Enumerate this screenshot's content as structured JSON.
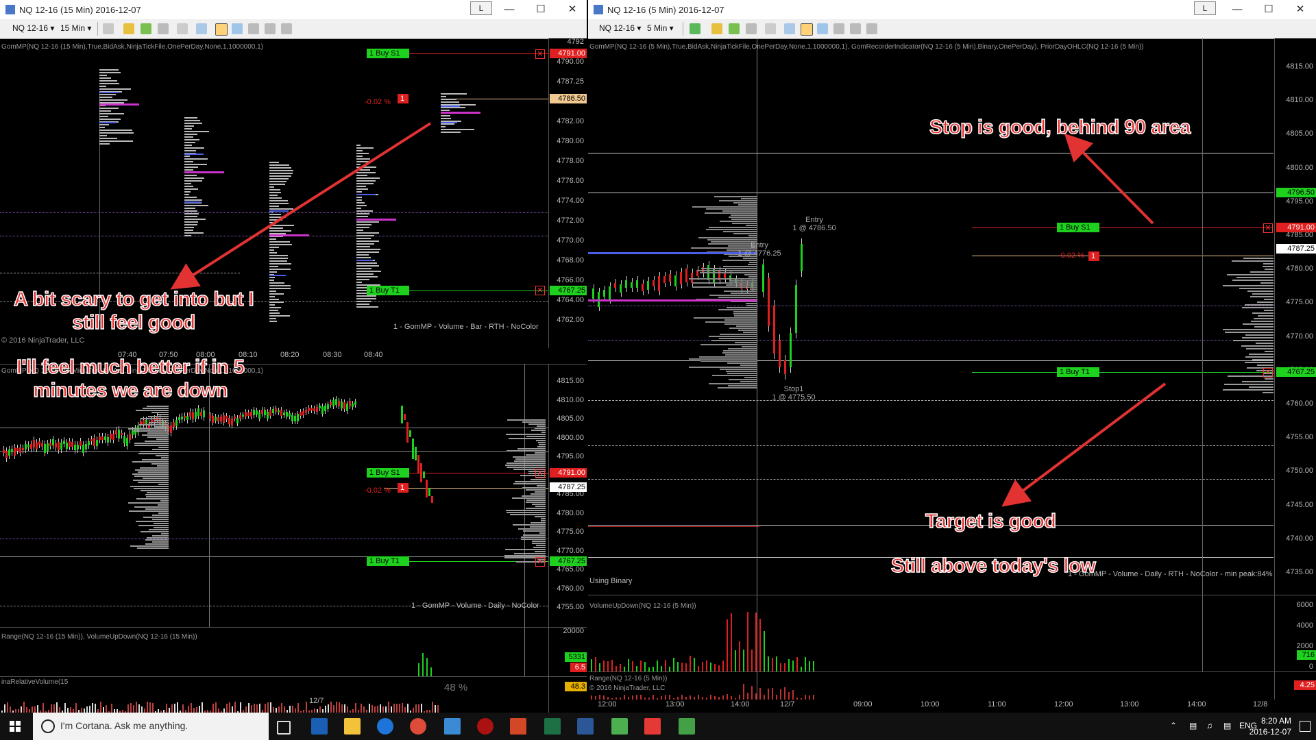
{
  "windows": {
    "left": {
      "title": "NQ 12-16 (15 Min)  2016-12-07",
      "lbtn": "L",
      "toolbar": {
        "instrument": "NQ 12-16",
        "interval": "15 Min"
      },
      "top_panel": {
        "indicator_label": "GomMP(NQ 12-16 (15 Min),True,BidAsk,NinjaTickFile,OnePerDay,None,1,1000000,1)",
        "ticks": [
          "4792",
          "4790.00",
          "4787.25",
          "4784.00",
          "4782.00",
          "4780.00",
          "4778.00",
          "4776.00",
          "4774.00",
          "4772.00",
          "4770.00",
          "4768.00",
          "4766.00",
          "4764.00",
          "4762.00"
        ],
        "price_tags": {
          "stop": "4791.00",
          "last": "4786.50",
          "target": "4767.25"
        },
        "orders": {
          "stop_label": "1  Buy S1",
          "target_label": "1  Buy T1",
          "pct": "-0.02 %",
          "qty": "1"
        },
        "footer": "1 - GomMP  - Volume - Bar - RTH - NoColor",
        "copyright": "© 2016 NinjaTrader, LLC",
        "x_labels": [
          "07:40",
          "07:50",
          "08:00",
          "08:10",
          "08:20",
          "08:30",
          "08:40"
        ]
      },
      "mid_panel": {
        "indicator_label": "GomMP(NQ 12-16 (15 Min),True,BidAsk,NinjaTickFile,OnePerDay,None,1,1000000,1)",
        "ticks": [
          "4815.00",
          "4810.00",
          "4805.00",
          "4800.00",
          "4795.00",
          "4790.00",
          "4785.00",
          "4780.00",
          "4775.00",
          "4770.00",
          "4765.00",
          "4760.00",
          "4755.00"
        ],
        "price_tags": {
          "stop": "4791.00",
          "last": "4787.25",
          "target": "4767.25"
        },
        "orders": {
          "stop_label": "1  Buy S1",
          "target_label": "1  Buy T1",
          "pct": "-0.02 %",
          "qty": "1"
        },
        "footer": "1 - GomMP  - Volume - Daily - NoColor"
      },
      "vol_panel": {
        "label": "Range(NQ 12-16 (15 Min)), VolumeUpDown(NQ 12-16 (15 Min))",
        "tick": "20000",
        "tags": [
          "5331",
          "6.5"
        ]
      },
      "rel_panel": {
        "label": "inaRelativeVolume(15",
        "pct": "48 %",
        "tag": "48.3",
        "x_label": "12/7"
      }
    },
    "right": {
      "title": "NQ 12-16 (5 Min)  2016-12-07",
      "lbtn": "L",
      "toolbar": {
        "instrument": "NQ 12-16",
        "interval": "5 Min"
      },
      "main_panel": {
        "indicator_label": "GomMP(NQ 12-16 (5 Min),True,BidAsk,NinjaTickFile,OnePerDay,None,1,1000000,1), GomRecorderIndicator(NQ 12-16 (5 Min),Binary,OnePerDay), PriorDayOHLC(NQ 12-16 (5 Min))",
        "ticks": [
          "4815.00",
          "4810.00",
          "4805.00",
          "4800.00",
          "4795.00",
          "4785.00",
          "4780.00",
          "4775.00",
          "4770.00",
          "4765.00",
          "4760.00",
          "4755.00",
          "4750.00",
          "4745.00",
          "4740.00",
          "4735.00"
        ],
        "price_tags": {
          "hi": "4796.50",
          "stop": "4791.00",
          "last": "4787.25",
          "target": "4767.25"
        },
        "orders": {
          "stop_label": "1  Buy S1",
          "target_label": "1  Buy T1",
          "pct": "-0.02 %",
          "qty": "1"
        },
        "entries": [
          {
            "label": "Entry",
            "fill": "1 @ 4786.50"
          },
          {
            "label": "Entry",
            "fill": "1 @ 4776.25"
          },
          {
            "label": "Stop1",
            "fill": "1 @ 4775.50"
          }
        ],
        "using": "Using Binary",
        "footer": "1 - GomMP  - Volume - Daily - RTH - NoColor - min peak:84%"
      },
      "vol_panel": {
        "label": "VolumeUpDown(NQ 12-16 (5 Min))",
        "ticks": [
          "6000",
          "4000",
          "2000",
          "0"
        ],
        "tag": "716"
      },
      "range_panel": {
        "label": "Range(NQ 12-16 (5 Min))",
        "copyright": "© 2016 NinjaTrader, LLC",
        "tag": "4.25"
      },
      "x_labels": [
        "12:00",
        "13:00",
        "14:00",
        "12/7",
        "09:00",
        "10:00",
        "11:00",
        "12:00",
        "13:00",
        "14:00",
        "12/8"
      ]
    }
  },
  "annotations": {
    "scary": "A bit scary to get into but I\nstill feel good",
    "better": "I'll feel much better if in 5\nminutes we are down",
    "stop": "Stop is good, behind 90 area",
    "target": "Target is good",
    "low": "Still above today's low"
  },
  "taskbar": {
    "cortana": "I'm Cortana. Ask me anything.",
    "lang": "ENG",
    "time": "8:20 AM",
    "date": "2016-12-07"
  },
  "colors": {
    "green": "#1fd11f",
    "red": "#e02020",
    "blue": "#4a5ee6",
    "magenta": "#cc33cc",
    "beige": "#f0c890"
  }
}
